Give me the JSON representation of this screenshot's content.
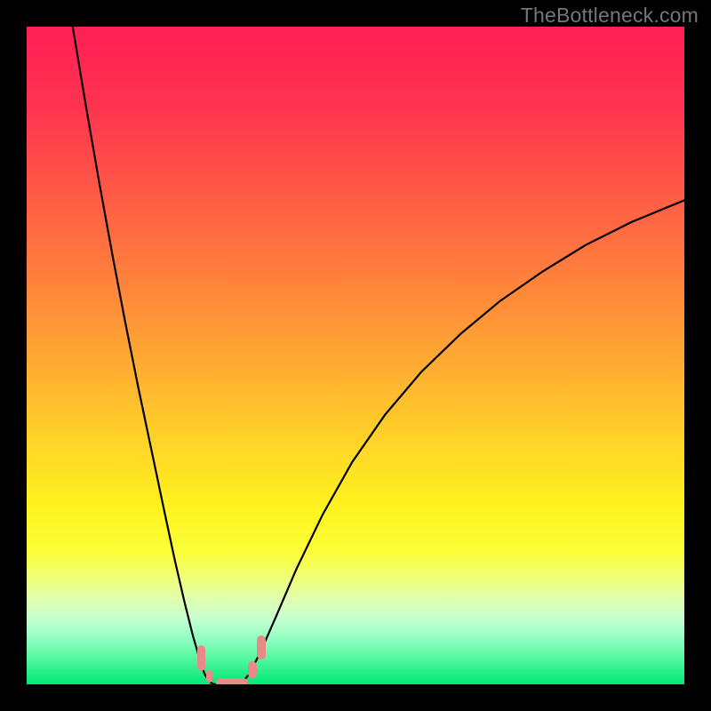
{
  "watermark": "TheBottleneck.com",
  "chart_data": {
    "type": "line",
    "title": "",
    "xlabel": "",
    "ylabel": "",
    "xlim": [
      0,
      100
    ],
    "ylim": [
      0,
      100
    ],
    "grid": false,
    "background": {
      "type": "vertical-gradient",
      "stops": [
        {
          "pct": 0,
          "color": "#ff1f55"
        },
        {
          "pct": 12,
          "color": "#ff3350"
        },
        {
          "pct": 25,
          "color": "#ff5946"
        },
        {
          "pct": 38,
          "color": "#ff803c"
        },
        {
          "pct": 50,
          "color": "#ffa733"
        },
        {
          "pct": 62,
          "color": "#ffd029"
        },
        {
          "pct": 73,
          "color": "#fff31f"
        },
        {
          "pct": 80,
          "color": "#fbff3a"
        },
        {
          "pct": 84,
          "color": "#efff7a"
        },
        {
          "pct": 87,
          "color": "#e0ffb0"
        },
        {
          "pct": 90,
          "color": "#c6ffd0"
        },
        {
          "pct": 93,
          "color": "#93ffc3"
        },
        {
          "pct": 96,
          "color": "#55f7a0"
        },
        {
          "pct": 100,
          "color": "#00e876"
        }
      ]
    },
    "series": [
      {
        "name": "left-branch",
        "color": "#000000",
        "width": 2.2,
        "x": [
          7.0,
          9.0,
          11.0,
          13.0,
          15.0,
          17.0,
          19.0,
          21.0,
          22.5,
          24.0,
          25.3,
          26.3,
          27.0,
          27.6,
          28.1,
          28.5
        ],
        "y": [
          100.0,
          88.0,
          76.5,
          65.5,
          55.0,
          45.0,
          35.5,
          26.0,
          19.0,
          12.5,
          7.3,
          3.9,
          1.7,
          0.6,
          0.2,
          0.0
        ]
      },
      {
        "name": "flat-valley",
        "color": "#000000",
        "width": 2.2,
        "x": [
          28.5,
          30.5,
          32.5
        ],
        "y": [
          0.0,
          0.0,
          0.0
        ]
      },
      {
        "name": "right-branch",
        "color": "#000000",
        "width": 2.2,
        "x": [
          32.5,
          33.8,
          35.5,
          38.0,
          41.0,
          45.0,
          49.5,
          54.5,
          60.0,
          66.0,
          72.0,
          78.5,
          85.0,
          92.0,
          100.0
        ],
        "y": [
          0.0,
          1.5,
          4.8,
          10.5,
          17.5,
          25.8,
          33.8,
          41.0,
          47.5,
          53.3,
          58.3,
          62.8,
          66.8,
          70.3,
          73.6
        ]
      }
    ],
    "markers": [
      {
        "name": "left-upper",
        "color": "#e88b87",
        "shape": "rounded-rect",
        "x_range": [
          26.0,
          27.2
        ],
        "y_range": [
          2.0,
          6.0
        ]
      },
      {
        "name": "left-lower",
        "color": "#e88b87",
        "shape": "rounded-rect",
        "x_range": [
          27.3,
          28.3
        ],
        "y_range": [
          0.3,
          2.1
        ]
      },
      {
        "name": "valley",
        "color": "#e88b87",
        "shape": "rounded-rect",
        "x_range": [
          28.8,
          33.6
        ],
        "y_range": [
          -0.6,
          1.0
        ]
      },
      {
        "name": "right-lower",
        "color": "#e88b87",
        "shape": "rounded-rect",
        "x_range": [
          33.6,
          35.0
        ],
        "y_range": [
          1.0,
          3.5
        ]
      },
      {
        "name": "right-upper",
        "color": "#e88b87",
        "shape": "rounded-rect",
        "x_range": [
          35.0,
          36.4
        ],
        "y_range": [
          3.8,
          7.4
        ]
      }
    ]
  }
}
